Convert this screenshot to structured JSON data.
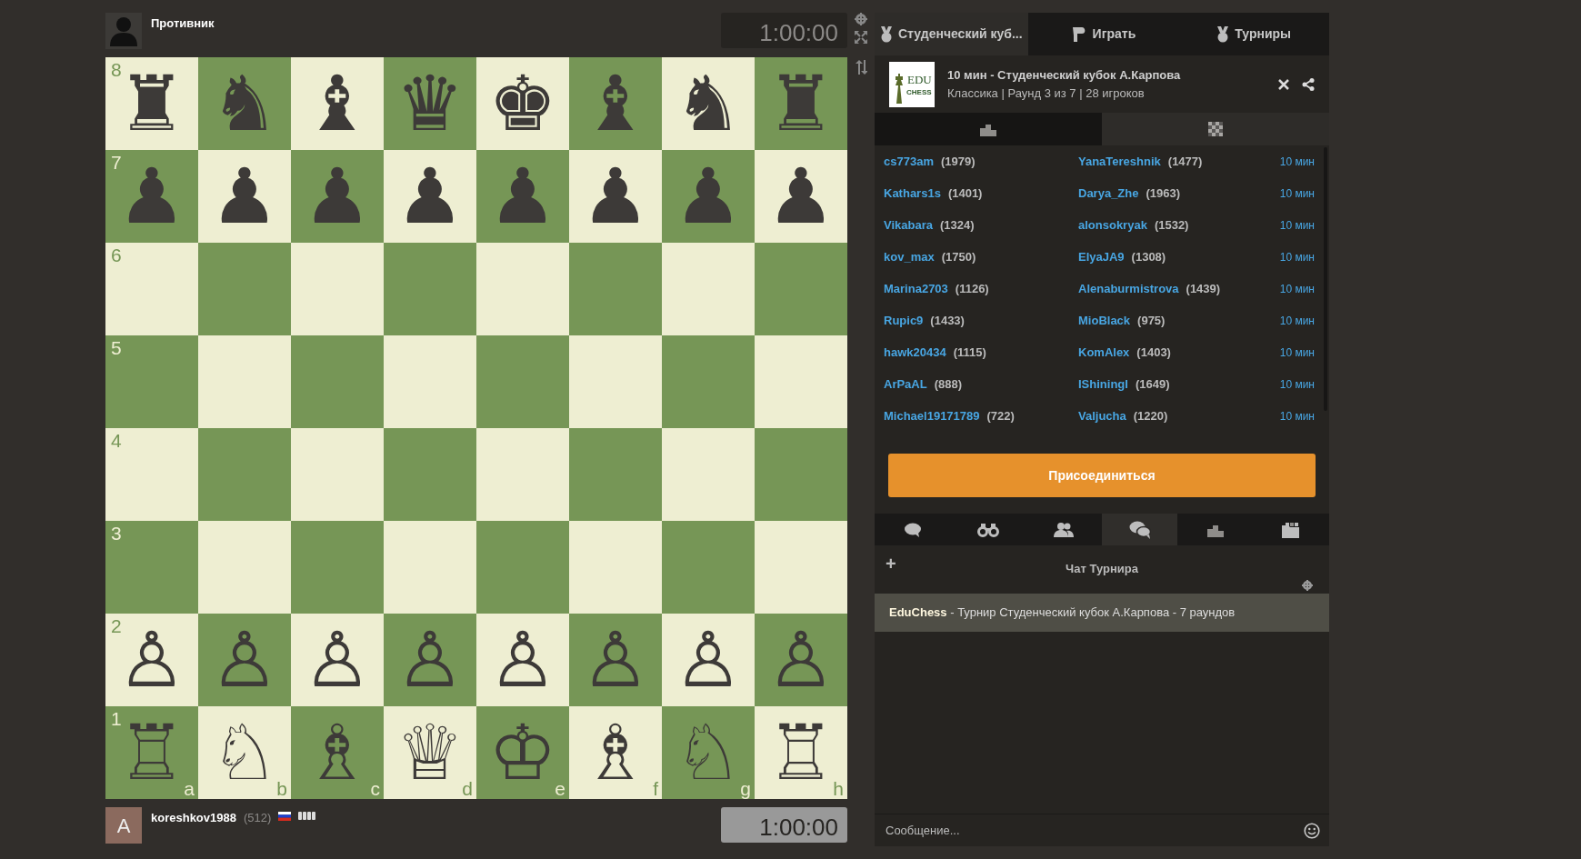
{
  "opponent": {
    "name": "Противник",
    "clock": "1:00:00",
    "active": false
  },
  "board": {
    "files": [
      "a",
      "b",
      "c",
      "d",
      "e",
      "f",
      "g",
      "h"
    ],
    "ranks": [
      {
        "label": "8",
        "pieces": [
          "♜",
          "♞",
          "♝",
          "♛",
          "♚",
          "♝",
          "♞",
          "♜"
        ]
      },
      {
        "label": "7",
        "pieces": [
          "♟",
          "♟",
          "♟",
          "♟",
          "♟",
          "♟",
          "♟",
          "♟"
        ]
      },
      {
        "label": "6"
      },
      {
        "label": "5"
      },
      {
        "label": "4"
      },
      {
        "label": "3"
      },
      {
        "label": "2",
        "pieces": [
          "♙",
          "♙",
          "♙",
          "♙",
          "♙",
          "♙",
          "♙",
          "♙"
        ]
      },
      {
        "label": "1",
        "pieces": [
          "♖",
          "♘",
          "♗",
          "♕",
          "♔",
          "♗",
          "♘",
          "♖"
        ]
      }
    ]
  },
  "player": {
    "avatar_letter": "A",
    "name": "koreshkov1988",
    "rating": "(512)",
    "clock": "1:00:00",
    "active": true
  },
  "tabs": [
    {
      "label": "Студенческий куб...",
      "selected": true
    },
    {
      "label": "Играть",
      "selected": false
    },
    {
      "label": "Турниры",
      "selected": false
    }
  ],
  "tournament": {
    "logo": {
      "text": "EDU",
      "subtext": "CHESS"
    },
    "title": "10 мин - Студенческий кубок А.Карпова",
    "subtitle": "Классика | Раунд 3 из 7 | 28 игроков"
  },
  "subtabs": [
    {
      "selected": false
    },
    {
      "selected": true
    }
  ],
  "pairings": [
    {
      "white": "cs773am",
      "white_rating": "(1979)",
      "black": "YanaTereshnik",
      "black_rating": "(1477)",
      "time": "10 мин"
    },
    {
      "white": "Kathars1s",
      "white_rating": "(1401)",
      "black": "Darya_Zhe",
      "black_rating": "(1963)",
      "time": "10 мин"
    },
    {
      "white": "Vikabara",
      "white_rating": "(1324)",
      "black": "alonsokryak",
      "black_rating": "(1532)",
      "time": "10 мин"
    },
    {
      "white": "kov_max",
      "white_rating": "(1750)",
      "black": "ElyaJA9",
      "black_rating": "(1308)",
      "time": "10 мин"
    },
    {
      "white": "Marina2703",
      "white_rating": "(1126)",
      "black": "Alenaburmistrova",
      "black_rating": "(1439)",
      "time": "10 мин"
    },
    {
      "white": "Rupic9",
      "white_rating": "(1433)",
      "black": "MioBlack",
      "black_rating": "(975)",
      "time": "10 мин"
    },
    {
      "white": "hawk20434",
      "white_rating": "(1115)",
      "black": "KomAlex",
      "black_rating": "(1403)",
      "time": "10 мин"
    },
    {
      "white": "ArPaAL",
      "white_rating": "(888)",
      "black": "IShiningI",
      "black_rating": "(1649)",
      "time": "10 мин"
    },
    {
      "white": "Michael19171789",
      "white_rating": "(722)",
      "black": "Valjucha",
      "black_rating": "(1220)",
      "time": "10 мин"
    }
  ],
  "join_button": "Присоединиться",
  "chat_tabs": [
    {
      "selected": false
    },
    {
      "selected": false
    },
    {
      "selected": false
    },
    {
      "selected": true
    },
    {
      "selected": false
    },
    {
      "selected": false
    }
  ],
  "chat": {
    "add": "+",
    "title": "Чат Турнира",
    "messages": [
      "**EduChess** - Турнир Студенческий кубок А.Карпова - 7 раундов"
    ],
    "placeholder": "Сообщение..."
  }
}
